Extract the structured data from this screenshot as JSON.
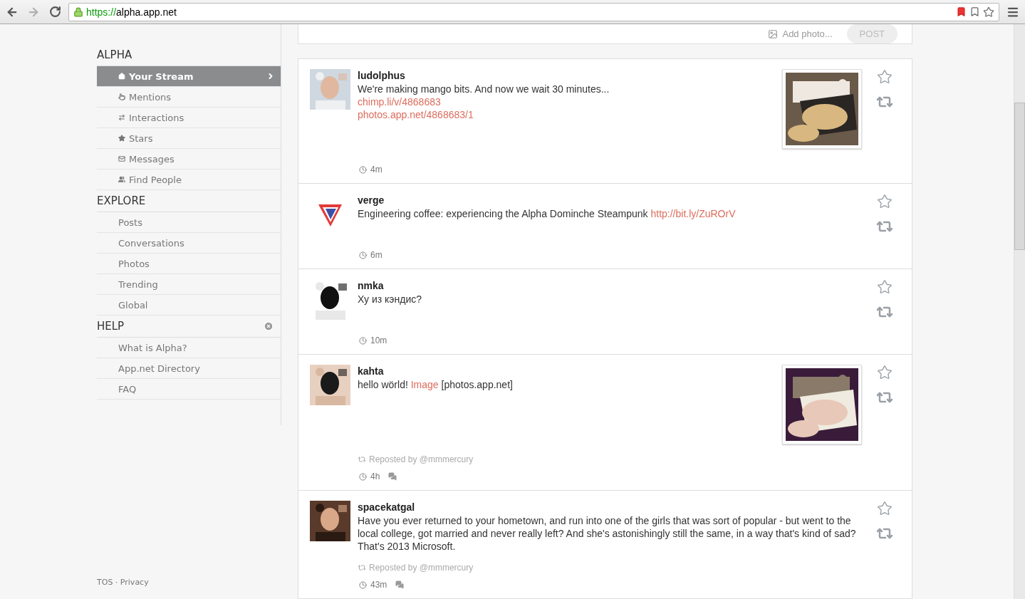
{
  "browser": {
    "url_scheme": "https://",
    "url_host": "alpha.app.net"
  },
  "sidebar": {
    "sections": [
      {
        "title": "ALPHA",
        "kind": "nav",
        "items": [
          {
            "label": "Your Stream",
            "selected": true
          },
          {
            "label": "Mentions",
            "selected": false
          },
          {
            "label": "Interactions",
            "selected": false
          },
          {
            "label": "Stars",
            "selected": false
          },
          {
            "label": "Messages",
            "selected": false
          },
          {
            "label": "Find People",
            "selected": false
          }
        ]
      },
      {
        "title": "EXPLORE",
        "kind": "plain",
        "items": [
          {
            "label": "Posts",
            "selected": false
          },
          {
            "label": "Conversations",
            "selected": false
          },
          {
            "label": "Photos",
            "selected": false
          },
          {
            "label": "Trending",
            "selected": false
          },
          {
            "label": "Global",
            "selected": false
          }
        ]
      },
      {
        "title": "HELP",
        "kind": "plain",
        "closable": true,
        "items": [
          {
            "label": "What is Alpha?",
            "selected": false
          },
          {
            "label": "App.net Directory",
            "selected": false
          },
          {
            "label": "FAQ",
            "selected": false
          }
        ]
      }
    ],
    "footer": "TOS · Privacy"
  },
  "composer": {
    "add_photo": "Add photo...",
    "post_button": "POST"
  },
  "posts": [
    {
      "user": "ludolphus",
      "avatar": {
        "kind": "picture"
      },
      "lines": [
        [
          {
            "kind": "text",
            "text": "We're making mango bits. And now we wait 30 minutes..."
          }
        ],
        [
          {
            "kind": "link",
            "text": "chimp.li/v/4868683"
          }
        ],
        [
          {
            "kind": "link",
            "text": "photos.app.net/4868683/1"
          }
        ]
      ],
      "thumbnail": {
        "kind": "picture"
      },
      "time": "4m",
      "conversation": false
    },
    {
      "user": "verge",
      "avatar": {
        "kind": "logo"
      },
      "lines": [
        [
          {
            "kind": "text",
            "text": "Engineering coffee: experiencing the Alpha Dominche Steampunk "
          },
          {
            "kind": "link",
            "text": "http://bit.ly/ZuROrV"
          }
        ]
      ],
      "time": "6m",
      "conversation": false
    },
    {
      "user": "nmka",
      "avatar": {
        "kind": "picture"
      },
      "lines": [
        [
          {
            "kind": "text",
            "text": "Ху из кэндис?"
          }
        ]
      ],
      "time": "10m",
      "conversation": false
    },
    {
      "user": "kahta",
      "avatar": {
        "kind": "picture"
      },
      "lines": [
        [
          {
            "kind": "text",
            "text": "hello wörld! "
          },
          {
            "kind": "link",
            "text": "Image"
          },
          {
            "kind": "text",
            "text": " [photos.app.net]"
          }
        ]
      ],
      "thumbnail": {
        "kind": "picture"
      },
      "repost": "Reposted by @mmmercury",
      "time": "4h",
      "conversation": true
    },
    {
      "user": "spacekatgal",
      "avatar": {
        "kind": "picture"
      },
      "lines": [
        [
          {
            "kind": "text",
            "text": "Have you ever returned to your hometown, and run into one of the girls that was sort of popular - but went to the local college, got married and never really left? And she's astonishingly still the same, in a way that's kind of sad? That's 2013 Microsoft."
          }
        ]
      ],
      "repost": "Reposted by @mmmercury",
      "time": "43m",
      "conversation": true
    }
  ]
}
